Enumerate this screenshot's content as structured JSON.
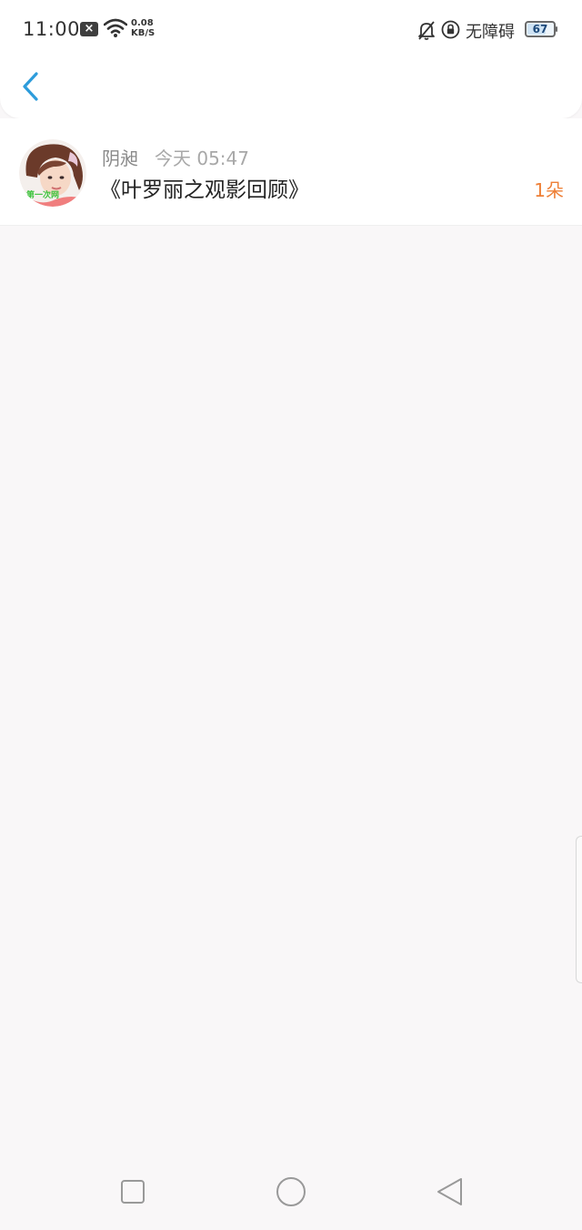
{
  "status_bar": {
    "time": "11:00",
    "notification_icon": "close-box-icon",
    "net_speed_value": "0.08",
    "net_speed_unit": "KB/S",
    "accessibility_label": "无障碍",
    "battery_level": "67",
    "battery_fraction": 0.67
  },
  "nav": {
    "back_icon": "chevron-left-icon",
    "accent_color": "#2d9cdb"
  },
  "list": {
    "items": [
      {
        "name": "阴昶",
        "time": "今天 05:47",
        "title": "《叶罗丽之观影回顾》",
        "count": "1朵",
        "avatar_watermark": "第一次网"
      }
    ]
  },
  "colors": {
    "background": "#f9f7f8",
    "count_accent": "#ee7f36"
  },
  "system_nav": {
    "recent_icon": "square-icon",
    "home_icon": "circle-icon",
    "back_icon": "triangle-back-icon"
  }
}
